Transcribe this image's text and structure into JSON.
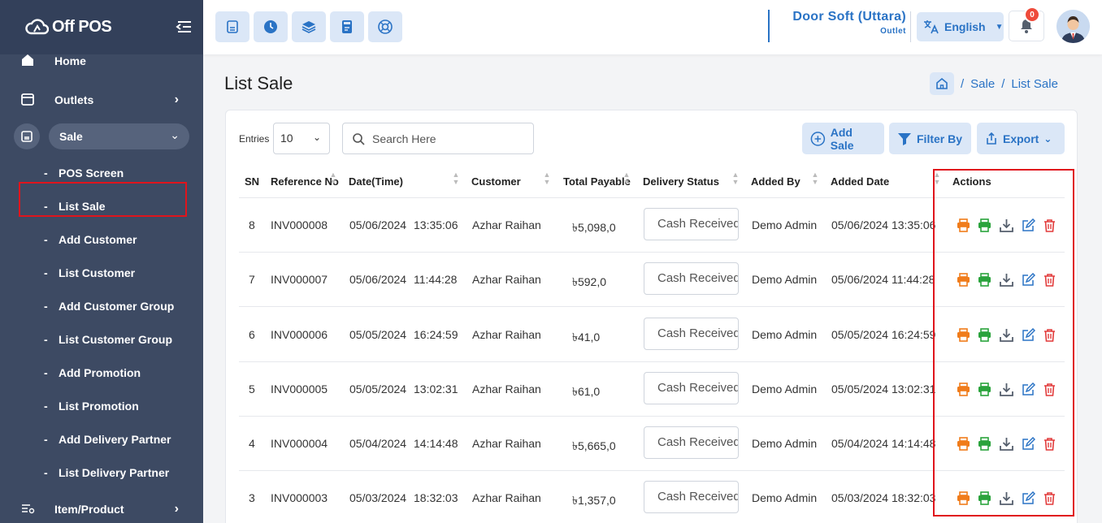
{
  "brand": {
    "name": "Off POS"
  },
  "sidebar": {
    "items": [
      {
        "label": "Home",
        "icon": "home-icon"
      },
      {
        "label": "Outlets",
        "icon": "store-icon"
      },
      {
        "label": "Sale",
        "icon": "register-icon"
      },
      {
        "label": "Item/Product",
        "icon": "list-filter-icon"
      }
    ],
    "sale_submenu": [
      "POS Screen",
      "List Sale",
      "Add Customer",
      "List Customer",
      "Add Customer Group",
      "List Customer Group",
      "Add Promotion",
      "List Promotion",
      "Add Delivery Partner",
      "List Delivery Partner"
    ],
    "active_item": "List Sale"
  },
  "topbar": {
    "outlet_name": "Door Soft (Uttara)",
    "outlet_label": "Outlet",
    "language": "English",
    "notification_count": "0"
  },
  "page": {
    "title": "List Sale",
    "breadcrumb": [
      "Sale",
      "List Sale"
    ]
  },
  "toolbar": {
    "entries_label": "Entries",
    "entries_value": "10",
    "search_placeholder": "Search Here",
    "add_label": "Add Sale",
    "filter_label": "Filter By",
    "export_label": "Export"
  },
  "table": {
    "headers": [
      "SN",
      "Reference No",
      "Date(Time)",
      "Customer",
      "Total Payable",
      "Delivery Status",
      "Added By",
      "Added Date",
      "Actions"
    ],
    "rows": [
      {
        "sn": "8",
        "ref": "INV000008",
        "date": "05/06/2024",
        "time": "13:35:06",
        "customer": "Azhar Raihan",
        "total": "৳5,098,0",
        "status": "Cash Received",
        "added_by": "Demo Admin",
        "added_date": "05/06/2024 13:35:06"
      },
      {
        "sn": "7",
        "ref": "INV000007",
        "date": "05/06/2024",
        "time": "11:44:28",
        "customer": "Azhar Raihan",
        "total": "৳592,0",
        "status": "Cash Received",
        "added_by": "Demo Admin",
        "added_date": "05/06/2024 11:44:28"
      },
      {
        "sn": "6",
        "ref": "INV000006",
        "date": "05/05/2024",
        "time": "16:24:59",
        "customer": "Azhar Raihan",
        "total": "৳41,0",
        "status": "Cash Received",
        "added_by": "Demo Admin",
        "added_date": "05/05/2024 16:24:59"
      },
      {
        "sn": "5",
        "ref": "INV000005",
        "date": "05/05/2024",
        "time": "13:02:31",
        "customer": "Azhar Raihan",
        "total": "৳61,0",
        "status": "Cash Received",
        "added_by": "Demo Admin",
        "added_date": "05/05/2024 13:02:31"
      },
      {
        "sn": "4",
        "ref": "INV000004",
        "date": "05/04/2024",
        "time": "14:14:48",
        "customer": "Azhar Raihan",
        "total": "৳5,665,0",
        "status": "Cash Received",
        "added_by": "Demo Admin",
        "added_date": "05/04/2024 14:14:48"
      },
      {
        "sn": "3",
        "ref": "INV000003",
        "date": "05/03/2024",
        "time": "18:32:03",
        "customer": "Azhar Raihan",
        "total": "৳1,357,0",
        "status": "Cash Received",
        "added_by": "Demo Admin",
        "added_date": "05/03/2024 18:32:03"
      }
    ]
  },
  "colors": {
    "sidebar_bg": "#3d4a63",
    "accent_blue": "#2a73c5",
    "action_orange": "#f07c1b",
    "action_green": "#2aa33c",
    "action_gray": "#555f6d",
    "action_red": "#e23b3b",
    "highlight_red": "#e0141c"
  },
  "action_icons": [
    "print-a4-icon",
    "print-pos-icon",
    "download-icon",
    "edit-icon",
    "delete-icon"
  ]
}
